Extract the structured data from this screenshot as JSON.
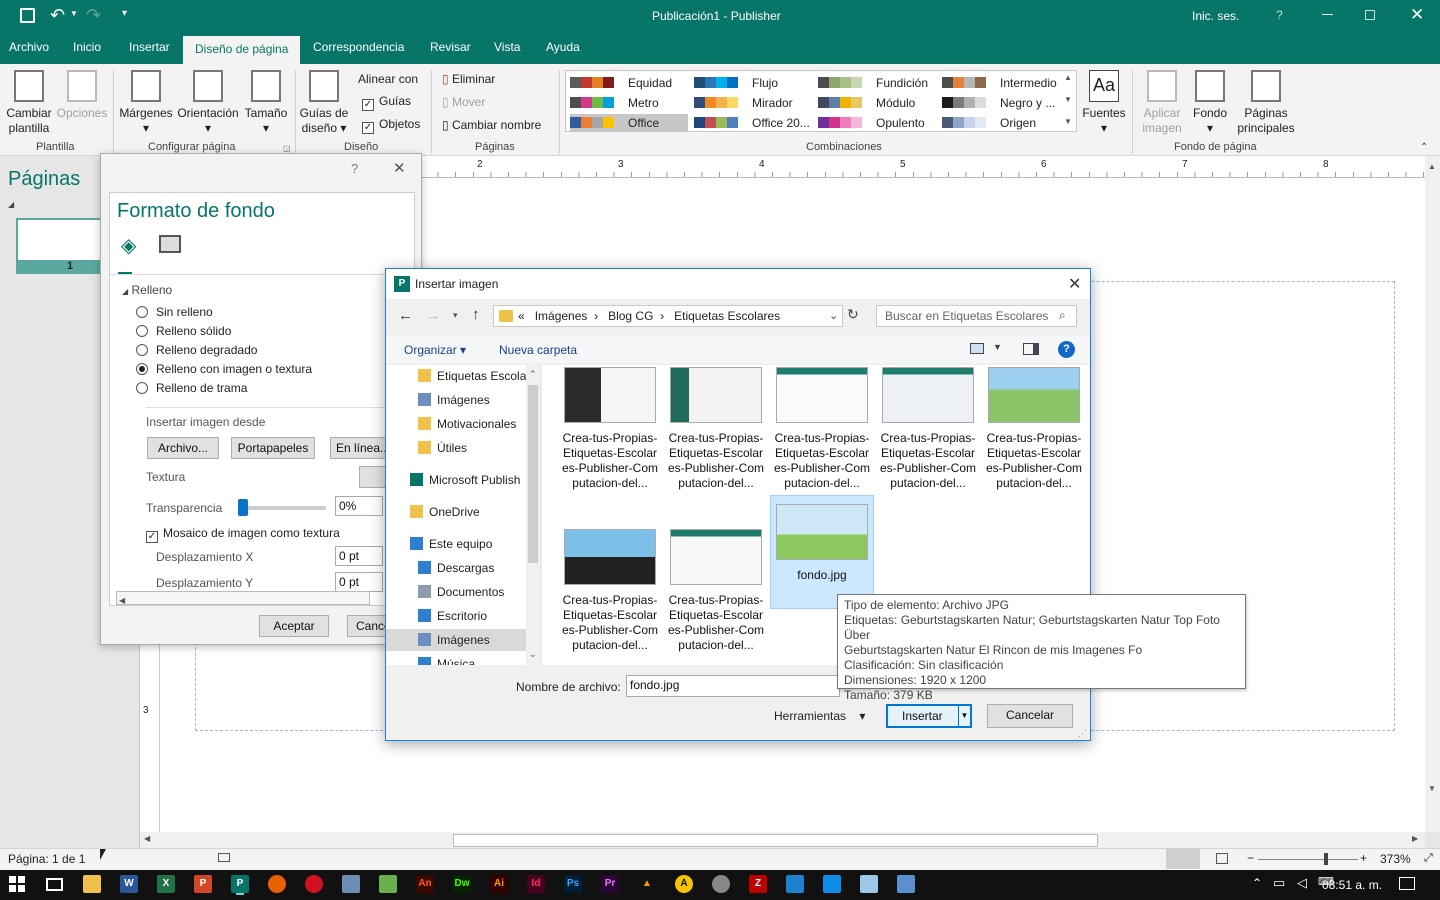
{
  "window": {
    "title": "Publicación1  -  Publisher",
    "signin": "Inic. ses.",
    "help": "?"
  },
  "tabs": [
    "Archivo",
    "Inicio",
    "Insertar",
    "Diseño de página",
    "Correspondencia",
    "Revisar",
    "Vista",
    "Ayuda"
  ],
  "active_tab": "Diseño de página",
  "ribbon": {
    "cambiar_plantilla": "Cambiar plantilla",
    "opciones": "Opciones",
    "grp_plantilla": "Plantilla",
    "margenes": "Márgenes",
    "orientacion": "Orientación",
    "tamano": "Tamaño",
    "grp_configurar": "Configurar página",
    "guias_diseno": "Guías de diseño",
    "alinear_con": "Alinear con",
    "guias": "Guías",
    "objetos": "Objetos",
    "grp_diseno": "Diseño",
    "eliminar": "Eliminar",
    "mover": "Mover",
    "cambiar_nombre": "Cambiar nombre",
    "grp_paginas": "Páginas",
    "grp_combinaciones": "Combinaciones",
    "fuentes": "Fuentes",
    "aplicar_imagen": "Aplicar imagen",
    "fondo": "Fondo",
    "paginas_principales": "Páginas principales",
    "grp_fondo": "Fondo de página"
  },
  "schemes": [
    {
      "name": "Equidad",
      "colors": [
        "#5a5a5a",
        "#c0392b",
        "#e67e22",
        "#7f1d1d"
      ]
    },
    {
      "name": "Flujo",
      "colors": [
        "#1f4e79",
        "#2e75b6",
        "#00b0f0",
        "#0070c0"
      ]
    },
    {
      "name": "Fundición",
      "colors": [
        "#4d4d4d",
        "#8ea86b",
        "#a9c08a",
        "#c8d6b0"
      ]
    },
    {
      "name": "Intermedio",
      "colors": [
        "#4d4d4d",
        "#e2813c",
        "#b7b7b7",
        "#8c6b4f"
      ]
    },
    {
      "name": "Metro",
      "colors": [
        "#4d4d4d",
        "#d13a8a",
        "#6dbd45",
        "#00a2d9"
      ]
    },
    {
      "name": "Mirador",
      "colors": [
        "#2f4e7a",
        "#f08a24",
        "#f3b24c",
        "#ffd966"
      ]
    },
    {
      "name": "Módulo",
      "colors": [
        "#3f4a5c",
        "#5b7fa8",
        "#f0b400",
        "#e8c860"
      ]
    },
    {
      "name": "Negro y ...",
      "colors": [
        "#1a1a1a",
        "#7a7a7a",
        "#b0b0b0",
        "#dcdcdc"
      ]
    },
    {
      "name": "Office",
      "colors": [
        "#2e5c9e",
        "#ed7d31",
        "#a5a5a5",
        "#ffc000"
      ]
    },
    {
      "name": "Office 20...",
      "colors": [
        "#1f497d",
        "#c0504d",
        "#9bbb59",
        "#4f81bd"
      ]
    },
    {
      "name": "Opulento",
      "colors": [
        "#7030a0",
        "#d1348c",
        "#f07cbd",
        "#f6b6d8"
      ]
    },
    {
      "name": "Origen",
      "colors": [
        "#4a5a78",
        "#8ea6c9",
        "#c6d3e6",
        "#e2e9f3"
      ]
    }
  ],
  "pages_pane": {
    "title": "Páginas",
    "page_number": "1"
  },
  "ruler_labels": [
    "2",
    "3",
    "4",
    "5",
    "6",
    "7",
    "8"
  ],
  "vruler_label": "3",
  "format_pane": {
    "title": "Formato de fondo",
    "help": "?",
    "section": "Relleno",
    "options": [
      "Sin relleno",
      "Relleno sólido",
      "Relleno degradado",
      "Relleno con imagen o textura",
      "Relleno de trama"
    ],
    "selected_option": 3,
    "insert_from": "Insertar imagen desde",
    "btn_archivo": "Archivo...",
    "btn_portapapeles": "Portapapeles",
    "btn_en_linea": "En línea...",
    "textura": "Textura",
    "transparencia": "Transparencia",
    "transparencia_value": "0%",
    "transparencia_fraction": 0.0,
    "mosaico": "Mosaico de imagen como textura",
    "desp_x": "Desplazamiento X",
    "desp_x_value": "0 pt",
    "desp_y": "Desplazamiento Y",
    "desp_y_value": "0 pt",
    "aceptar": "Aceptar",
    "cancelar": "Cance"
  },
  "dialog": {
    "title": "Insertar imagen",
    "breadcrumb": [
      "Imágenes",
      "Blog CG",
      "Etiquetas Escolares"
    ],
    "breadcrumb_prefix": "«",
    "search_placeholder": "Buscar en Etiquetas Escolares",
    "organizar": "Organizar",
    "nueva_carpeta": "Nueva carpeta",
    "nav": [
      {
        "label": "Etiquetas Escolar",
        "icon": "folder-icon"
      },
      {
        "label": "Imágenes",
        "icon": "pictures-folder-icon"
      },
      {
        "label": "Motivacionales",
        "icon": "folder-icon"
      },
      {
        "label": "Útiles",
        "icon": "folder-icon"
      },
      {
        "label": "Microsoft Publish",
        "icon": "publisher-icon"
      },
      {
        "label": "OneDrive",
        "icon": "onedrive-icon"
      },
      {
        "label": "Este equipo",
        "icon": "computer-icon"
      },
      {
        "label": "Descargas",
        "icon": "downloads-icon"
      },
      {
        "label": "Documentos",
        "icon": "documents-icon"
      },
      {
        "label": "Escritorio",
        "icon": "desktop-icon"
      },
      {
        "label": "Imágenes",
        "icon": "pictures-folder-icon"
      },
      {
        "label": "Música",
        "icon": "music-icon"
      }
    ],
    "files": [
      "Crea-tus-Propias-Etiquetas-Escolares-Publisher-Computacion-del...",
      "Crea-tus-Propias-Etiquetas-Escolares-Publisher-Computacion-del...",
      "Crea-tus-Propias-Etiquetas-Escolares-Publisher-Computacion-del...",
      "Crea-tus-Propias-Etiquetas-Escolares-Publisher-Computacion-del...",
      "Crea-tus-Propias-Etiquetas-Escolares-Publisher-Computacion-del...",
      "Crea-tus-Propias-Etiquetas-Escolares-Publisher-Computacion-del...",
      "Crea-tus-Propias-Etiquetas-Escolares-Publisher-Computacion-del...",
      "fondo.jpg"
    ],
    "file_lines": [
      [
        "Crea-tus-Propias",
        "-Etiquetas-Escola",
        "res-Publisher-Co",
        "mputacion-del..."
      ]
    ],
    "file_label": "Nombre de archivo:",
    "file_value": "fondo.jpg",
    "herramientas": "Herramientas",
    "insertar": "Insertar",
    "cancelar": "Cancelar"
  },
  "tooltip": [
    "Tipo de elemento: Archivo JPG",
    "Etiquetas: Geburtstagskarten Natur; Geburtstagskarten Natur Top Foto Über",
    "Geburtstagskarten Natur El Rincon de mis Imagenes Fo",
    "Clasificación: Sin clasificación",
    "Dimensiones: 1920 x 1200",
    "Tamaño: 379 KB"
  ],
  "status": {
    "page": "Página: 1 de 1",
    "zoom": "373%"
  },
  "taskbar": {
    "time": "08:51 a. m."
  },
  "colors": {
    "accent": "#077568",
    "selection": "#cce8ff",
    "dialog_border": "#1883d7"
  }
}
